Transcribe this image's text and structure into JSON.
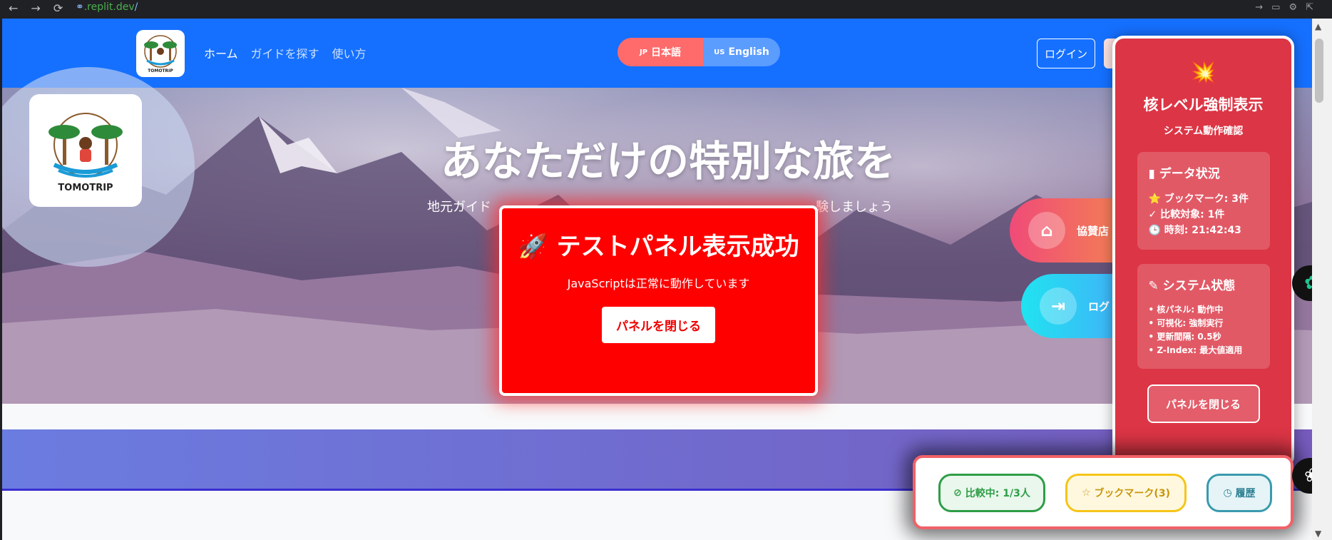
{
  "browser": {
    "url_host": ".replit.dev",
    "url_path": "/",
    "nav_icons": [
      "back-icon",
      "forward-icon",
      "reload-icon"
    ]
  },
  "header": {
    "nav": [
      "ホーム",
      "ガイドを探す",
      "使い方"
    ],
    "lang_jp_flag": "JP",
    "lang_jp": "日本語",
    "lang_en_flag": "US",
    "lang_en": "English",
    "login": "ログイン"
  },
  "logo": {
    "text": "TOMOTRIP"
  },
  "hero": {
    "title": "あなただけの特別な旅を",
    "subtitle_left": "地元ガイド",
    "subtitle_right": "験しましょう"
  },
  "side_buttons": {
    "shop": "協賛店",
    "login": "ログ"
  },
  "test_panel": {
    "icon": "🚀",
    "title": "テストパネル表示成功",
    "message": "JavaScriptは正常に動作しています",
    "close": "パネルを閉じる"
  },
  "nuke_panel": {
    "icon": "💥",
    "title": "核レベル強制表示",
    "subtitle": "システム動作確認",
    "data_card": {
      "heading": "データ状況",
      "rows": [
        "⭐ ブックマーク: 3件",
        "✓ 比較対象: 1件",
        "🕒 時刻: 21:42:43"
      ]
    },
    "system_card": {
      "heading": "システム状態",
      "rows": [
        "• 核パネル: 動作中",
        "• 可視化: 強制実行",
        "• 更新間隔: 0.5秒",
        "• Z-Index: 最大値適用"
      ]
    },
    "close": "パネルを閉じる"
  },
  "bottom_bar": {
    "compare": "比較中: 1/3人",
    "bookmark": "ブックマーク(3)",
    "history": "履歴"
  }
}
